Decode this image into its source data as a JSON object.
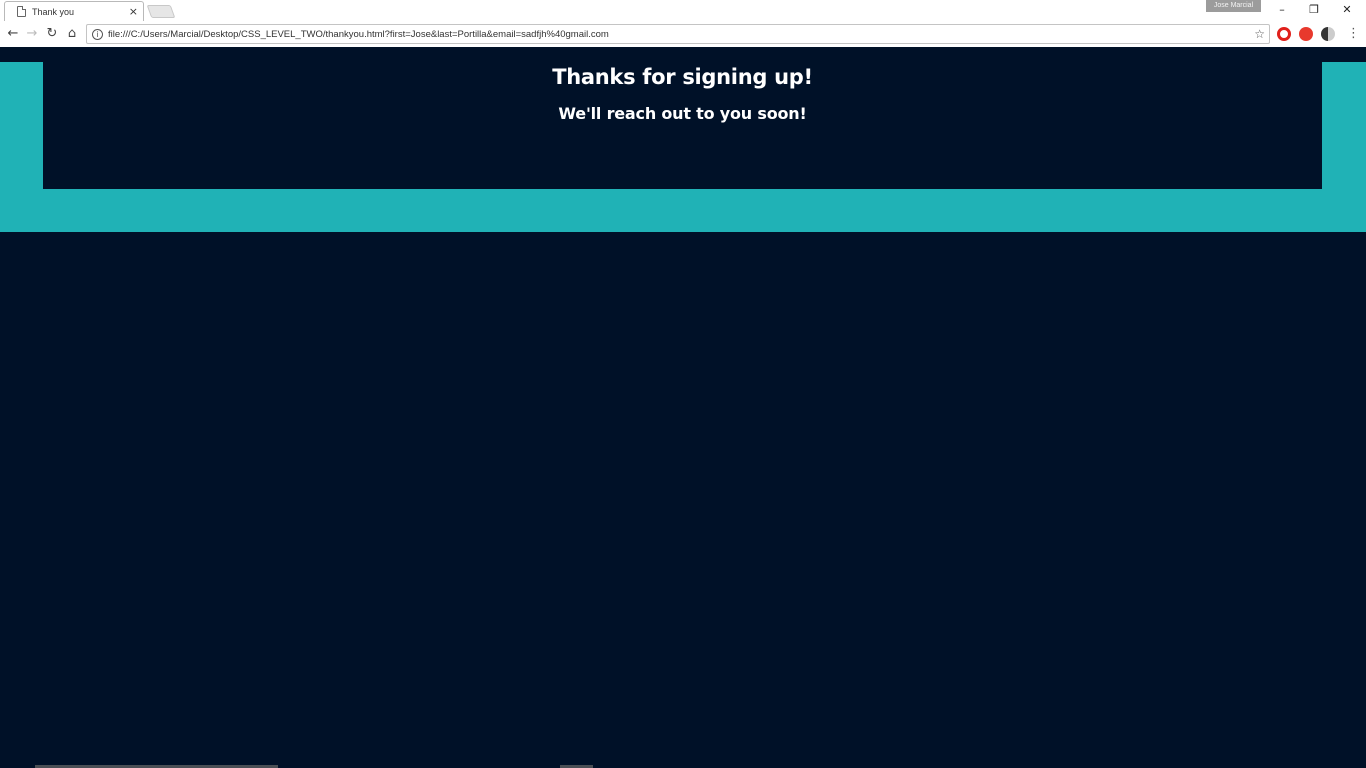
{
  "browser": {
    "tab_title": "Thank you",
    "tab_close": "×",
    "profile_name": "Jose Marcial",
    "window_controls": {
      "minimize": "–",
      "restore": "❐",
      "close": "✕"
    },
    "nav": {
      "back": "←",
      "forward": "→",
      "reload": "↻",
      "home": "⌂"
    },
    "url": "file:///C:/Users/Marcial/Desktop/CSS_LEVEL_TWO/thankyou.html?first=Jose&last=Portilla&email=sadfjh%40gmail.com",
    "info_glyph": "i",
    "star_glyph": "☆",
    "menu_glyph": "⋮",
    "extensions": [
      {
        "name": "opera-icon",
        "color": "#e0201b"
      },
      {
        "name": "adblock-icon",
        "color": "#e8392d"
      },
      {
        "name": "dark-mode-icon",
        "color": "#333333"
      }
    ]
  },
  "page": {
    "title": "Thanks for signing up!",
    "subtitle": "We'll reach out to you soon!",
    "colors": {
      "background": "#001128",
      "accent": "#20b2b6",
      "text": "#ffffff"
    }
  }
}
